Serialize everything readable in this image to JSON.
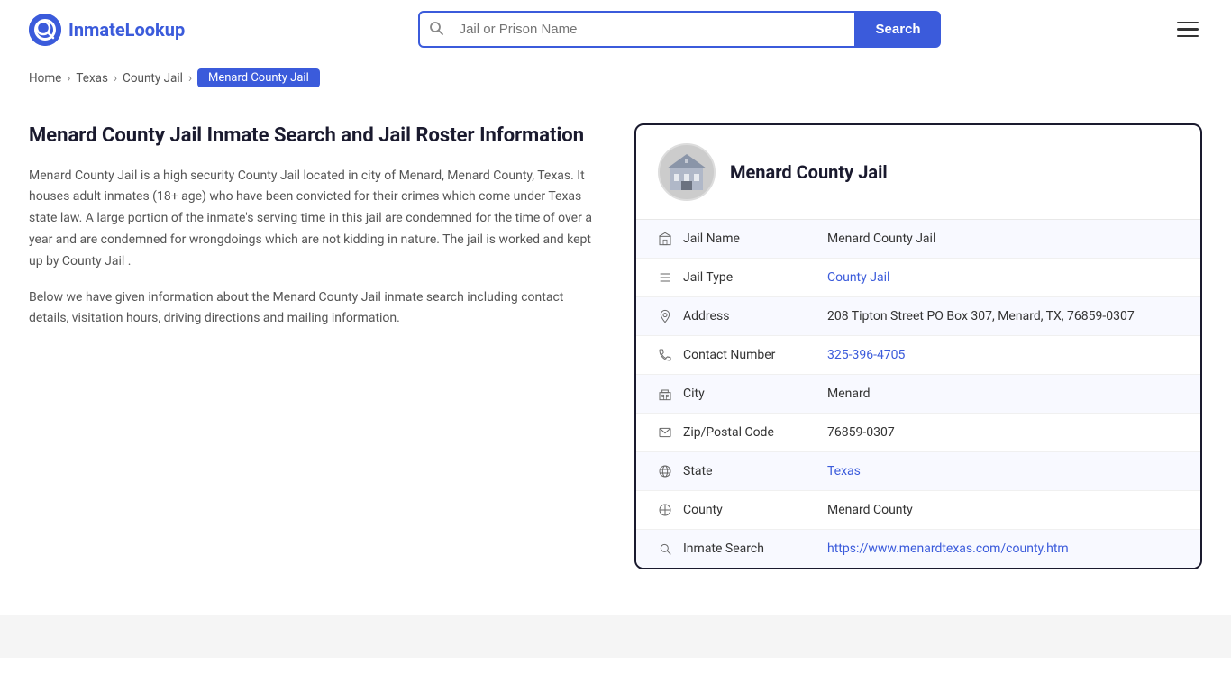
{
  "header": {
    "logo_text_part1": "Inmate",
    "logo_text_part2": "Lookup",
    "search_placeholder": "Jail or Prison Name",
    "search_button_label": "Search"
  },
  "breadcrumb": {
    "home": "Home",
    "texas": "Texas",
    "county_jail": "County Jail",
    "current": "Menard County Jail"
  },
  "left": {
    "page_title": "Menard County Jail Inmate Search and Jail Roster Information",
    "description1": "Menard County Jail is a high security County Jail located in city of Menard, Menard County, Texas. It houses adult inmates (18+ age) who have been convicted for their crimes which come under Texas state law. A large portion of the inmate's serving time in this jail are condemned for the time of over a year and are condemned for wrongdoings which are not kidding in nature. The jail is worked and kept up by County Jail .",
    "description2": "Below we have given information about the Menard County Jail inmate search including contact details, visitation hours, driving directions and mailing information."
  },
  "card": {
    "jail_name_header": "Menard County Jail",
    "rows": [
      {
        "icon": "jail-icon",
        "label": "Jail Name",
        "value": "Menard County Jail",
        "link": null
      },
      {
        "icon": "list-icon",
        "label": "Jail Type",
        "value": "County Jail",
        "link": "#"
      },
      {
        "icon": "location-icon",
        "label": "Address",
        "value": "208 Tipton Street PO Box 307, Menard, TX, 76859-0307",
        "link": null
      },
      {
        "icon": "phone-icon",
        "label": "Contact Number",
        "value": "325-396-4705",
        "link": "tel:325-396-4705"
      },
      {
        "icon": "city-icon",
        "label": "City",
        "value": "Menard",
        "link": null
      },
      {
        "icon": "zip-icon",
        "label": "Zip/Postal Code",
        "value": "76859-0307",
        "link": null
      },
      {
        "icon": "globe-icon",
        "label": "State",
        "value": "Texas",
        "link": "#"
      },
      {
        "icon": "county-icon",
        "label": "County",
        "value": "Menard County",
        "link": null
      },
      {
        "icon": "search-icon",
        "label": "Inmate Search",
        "value": "https://www.menardtexas.com/county.htm",
        "link": "https://www.menardtexas.com/county.htm"
      }
    ]
  }
}
